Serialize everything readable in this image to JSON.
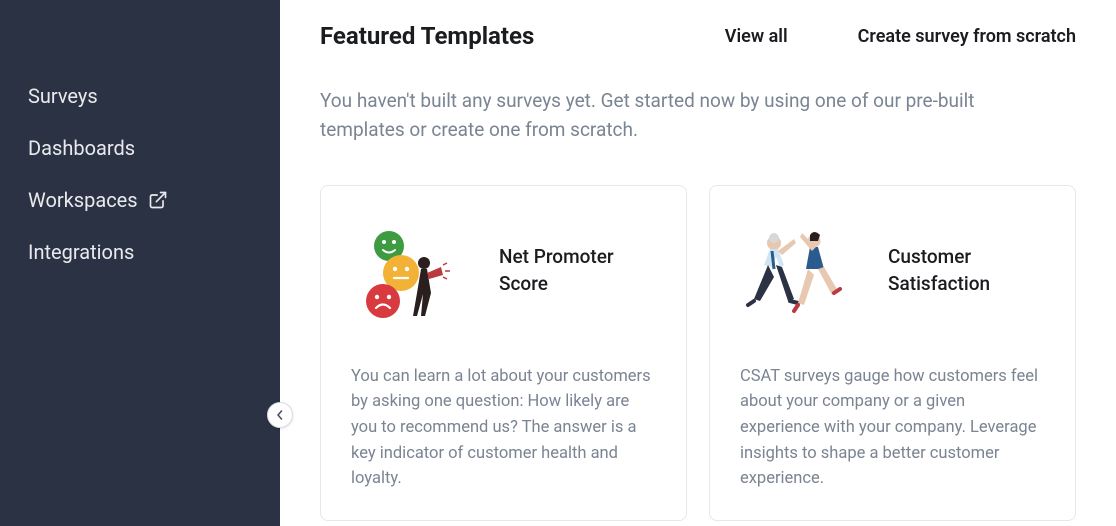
{
  "sidebar": {
    "items": [
      {
        "label": "Surveys"
      },
      {
        "label": "Dashboards"
      },
      {
        "label": "Workspaces"
      },
      {
        "label": "Integrations"
      }
    ]
  },
  "header": {
    "title": "Featured Templates",
    "view_all": "View all",
    "create": "Create survey from scratch"
  },
  "subtitle": "You haven't built any surveys yet. Get started now by using one of our pre-built templates or create one from scratch.",
  "templates": [
    {
      "title": "Net Promoter Score",
      "description": "You can learn a lot about your customers by asking one question: How likely are you to recommend us? The answer is a key indicator of customer health and loyalty."
    },
    {
      "title": "Customer Satisfaction",
      "description": "CSAT surveys gauge how customers feel about your company or a given experience with your company. Leverage insights to shape a better customer experience."
    }
  ]
}
